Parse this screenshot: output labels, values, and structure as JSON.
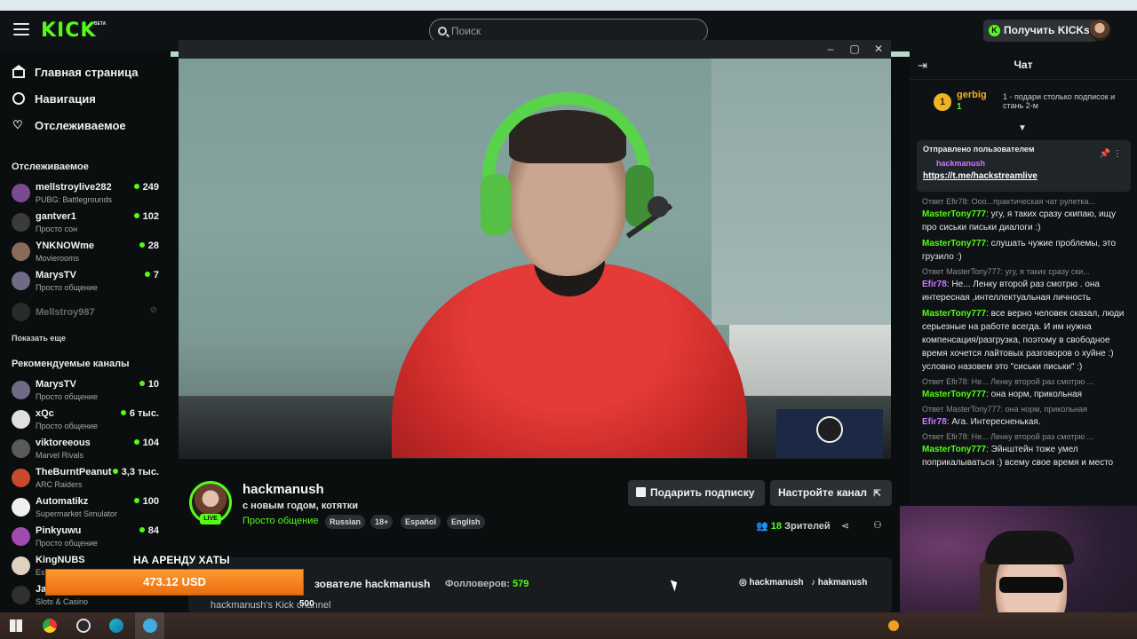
{
  "header": {
    "logo": "KICK",
    "logo_badge": "BETA",
    "search_placeholder": "Поиск",
    "get_kicks_label": "Получить KICKs"
  },
  "sidebar": {
    "nav": [
      {
        "label": "Главная страница",
        "icon": "home-icon"
      },
      {
        "label": "Навигация",
        "icon": "compass-icon"
      },
      {
        "label": "Отслеживаемое",
        "icon": "heart-icon"
      }
    ],
    "followed_title": "Отслеживаемое",
    "followed": [
      {
        "name": "mellstroylive282",
        "sub": "PUBG: Battlegrounds",
        "viewers": "249",
        "color": "#7b4a8e"
      },
      {
        "name": "gantver1",
        "sub": "Просто сон",
        "viewers": "102",
        "color": "#3b3b3b"
      },
      {
        "name": "YNKNOWme",
        "sub": "Movierooms",
        "viewers": "28",
        "color": "#8a6a5a"
      },
      {
        "name": "MarysTV",
        "sub": "Просто общение",
        "viewers": "7",
        "color": "#6f6a86"
      },
      {
        "name": "Mellstroy987",
        "sub": "",
        "viewers": "",
        "color": "#4a4a4a"
      }
    ],
    "show_more": "Показать еще",
    "recommended_title": "Рекомендуемые каналы",
    "recommended": [
      {
        "name": "MarysTV",
        "sub": "Просто общение",
        "viewers": "10",
        "color": "#6f6a86"
      },
      {
        "name": "xQc",
        "sub": "Просто общение",
        "viewers": "6 тыс.",
        "color": "#e0e0e0"
      },
      {
        "name": "viktoreeous",
        "sub": "Marvel Rivals",
        "viewers": "104",
        "color": "#5a5a5a"
      },
      {
        "name": "TheBurntPeanut",
        "sub": "ARC Raiders",
        "viewers": "3,3 тыс.",
        "color": "#c94a2a"
      },
      {
        "name": "Automatikz",
        "sub": "Supermarket Simulator",
        "viewers": "100",
        "color": "#f0f0f0"
      },
      {
        "name": "Pinkyuwu",
        "sub": "Просто общение",
        "viewers": "84",
        "color": "#a14ab0"
      },
      {
        "name": "KingNUBS",
        "sub": "Es",
        "viewers": "",
        "color": "#e0d0c0"
      },
      {
        "name": "Ja",
        "sub": "Slots & Casino",
        "viewers": "",
        "color": "#303030"
      }
    ]
  },
  "channel": {
    "name": "hackmanush",
    "live": "LIVE",
    "title": "с новым годом, котятки",
    "category": "Просто общение",
    "tags": [
      "Russian",
      "18+",
      "Español",
      "English"
    ],
    "gift_sub_button": "Подарить подписку",
    "settings_button": "Настройте канал",
    "viewers_count": "18",
    "viewers_label": "Зрителей"
  },
  "about": {
    "title": "зователе hackmanush",
    "followers_label": "Фолловеров:",
    "followers_count": "579",
    "desc": "hackmanush's Kick channel",
    "socials": [
      "hackmanush",
      "hakmanush"
    ]
  },
  "donation": {
    "title": "НА АРЕНДУ ХАТЫ",
    "amount": "473.12 USD",
    "goal": "500"
  },
  "chat": {
    "title": "Чат",
    "top_gifter": {
      "rank": "1",
      "name": "gerbig",
      "count": "1",
      "hint": "1 - подари столько подписок и стань 2-м"
    },
    "pinned_label": "Отправлено пользователем",
    "pinned_user": "hackmanush",
    "pinned_link": "https://t.me/hackstreamlive",
    "messages": [
      {
        "reply": "Ответ Efir78: Ооо...практическая чат рулетка...",
        "user": "MasterTony777",
        "text": "угу, я таких сразу скипаю, ищу про сиськи письки диалоги :)",
        "purple": false
      },
      {
        "reply": "",
        "user": "MasterTony777",
        "text": "слушать чужие проблемы, это грузило :)",
        "purple": false
      },
      {
        "reply": "Ответ MasterTony777: угу, я таких сразу ски...",
        "user": "Efir78",
        "text": "Не... Ленку второй раз смотрю . она интересная ,интеллектуальная личность",
        "purple": true
      },
      {
        "reply": "",
        "user": "MasterTony777",
        "text": "все верно человек сказал, люди серьезные на работе всегда. И им нужна компенсация/разгрузка, поэтому в свободное время хочется лайтовых разговоров о хуйне :) условно назовем это \"сиськи письки\" :)",
        "purple": false
      },
      {
        "reply": "Ответ Efir78: Не... Ленку второй раз смотрю ...",
        "user": "MasterTony777",
        "text": "она норм, прикольная",
        "purple": false
      },
      {
        "reply": "Ответ MasterTony777: она норм, прикольная",
        "user": "Efir78",
        "text": "Ага. Интересненькая.",
        "purple": true
      },
      {
        "reply": "Ответ Efir78: Не... Ленку второй раз смотрю ...",
        "user": "MasterTony777",
        "text": "Эйнштейн тоже умел поприкалываться :) всему свое время и место",
        "purple": false
      }
    ]
  },
  "colors": {
    "accent": "#53fc18",
    "background": "#0b0e0f",
    "donation_bar": "#f58220"
  }
}
